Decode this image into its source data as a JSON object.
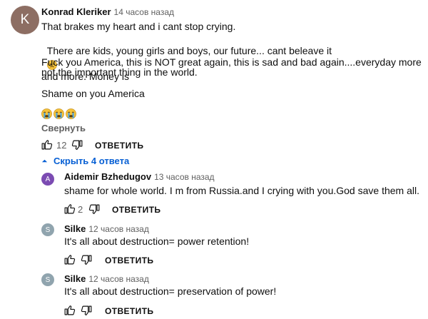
{
  "comment": {
    "avatar_letter": "K",
    "avatar_color": "#8d6e63",
    "author": "Konrad Kleriker",
    "time": "14 часов назад",
    "lines": [
      "That brakes my heart and i cant stop crying.",
      "There are kids, young girls and boys, our future... cant beleave it",
      "Fuck you America, this is NOT great again, this is sad and bad again....everyday more and more. Money is",
      "not the important thing in the world.",
      "Shame on you America"
    ],
    "collapse_label": "Свернуть",
    "likes": "12",
    "reply_label": "ОТВЕТИТЬ",
    "hide_replies_label": "Скрыть 4 ответа"
  },
  "replies": [
    {
      "avatar_letter": "A",
      "avatar_color": "#7b4bb2",
      "author": "Aidemir Bzhedugov",
      "time": "13 часов назад",
      "text": "shame for whole world. I m from Russia.and I crying with you.God save them all.",
      "likes": "2",
      "reply_label": "ОТВЕТИТЬ"
    },
    {
      "avatar_letter": "S",
      "avatar_color": "#90a4ae",
      "author": "Silke",
      "time": "12 часов назад",
      "text": "It's all about destruction= power retention!",
      "likes": "",
      "reply_label": "ОТВЕТИТЬ"
    },
    {
      "avatar_letter": "S",
      "avatar_color": "#90a4ae",
      "author": "Silke",
      "time": "12 часов назад",
      "text": "It's all about destruction= preservation of power!",
      "likes": "",
      "reply_label": "ОТВЕТИТЬ"
    }
  ],
  "colors": {
    "link": "#065fd4",
    "secondary": "#606060",
    "emoji": "#f5c33b"
  },
  "icons": [
    "thumb-up-icon",
    "thumb-down-icon",
    "chevron-up-icon",
    "crying-emoji-icon"
  ]
}
